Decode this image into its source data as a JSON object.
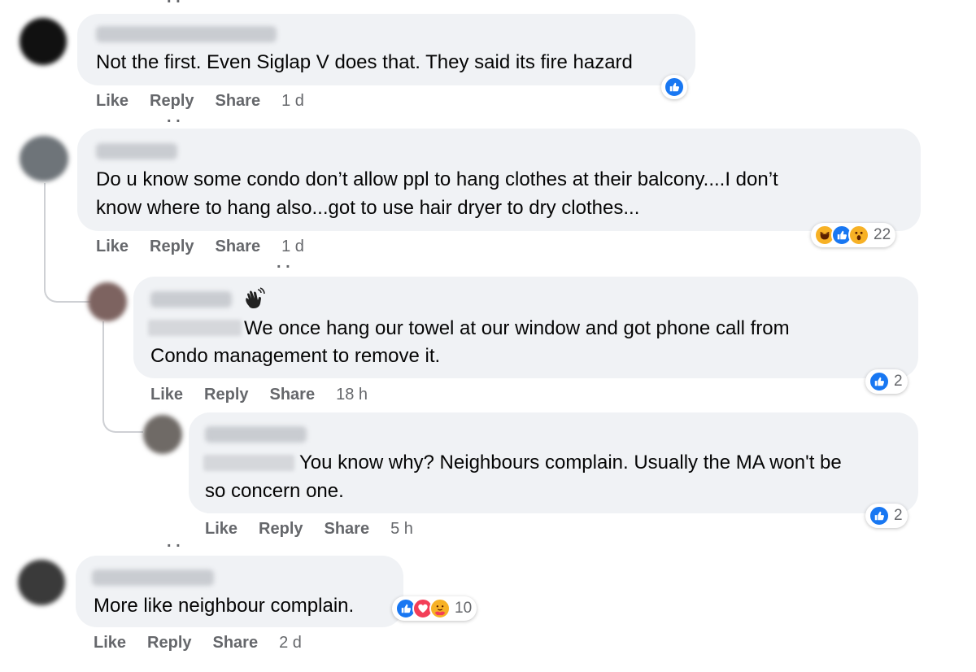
{
  "comments": [
    {
      "text_lines": [
        "Not the first. Even Siglap V does that. They said its fire hazard"
      ],
      "actions": {
        "like": "Like",
        "reply": "Reply",
        "share": "Share",
        "time": "1 d"
      }
    },
    {
      "text_lines": [
        "Do u know some condo don’t allow ppl to hang clothes at their balcony....I don’t",
        "know where to hang also...got to use hair dryer to dry clothes..."
      ],
      "reaction_count": "22",
      "actions": {
        "like": "Like",
        "reply": "Reply",
        "share": "Share",
        "time": "1 d"
      }
    },
    {
      "text_lines": [
        "We once hang our towel at our window and got phone call from",
        "Condo management to remove it."
      ],
      "reaction_count": "2",
      "actions": {
        "like": "Like",
        "reply": "Reply",
        "share": "Share",
        "time": "18 h"
      }
    },
    {
      "text_lines": [
        "You know why? Neighbours complain. Usually the MA won't be",
        "so concern one."
      ],
      "reaction_count": "2",
      "actions": {
        "like": "Like",
        "reply": "Reply",
        "share": "Share",
        "time": "5 h"
      }
    },
    {
      "text_lines": [
        "More like neighbour complain."
      ],
      "reaction_count": "10",
      "actions": {
        "like": "Like",
        "reply": "Reply",
        "share": "Share",
        "time": "2 d"
      }
    }
  ],
  "icons": {
    "like": "thumbs-up-icon",
    "haha": "laughing-emoji-icon",
    "wow": "wow-emoji-icon",
    "love": "heart-icon",
    "care": "care-emoji-icon",
    "wave": "waving-hand-icon"
  },
  "colors": {
    "bubble": "#f0f2f5",
    "like_blue": "#1877f2",
    "meta_gray": "#65676b"
  }
}
